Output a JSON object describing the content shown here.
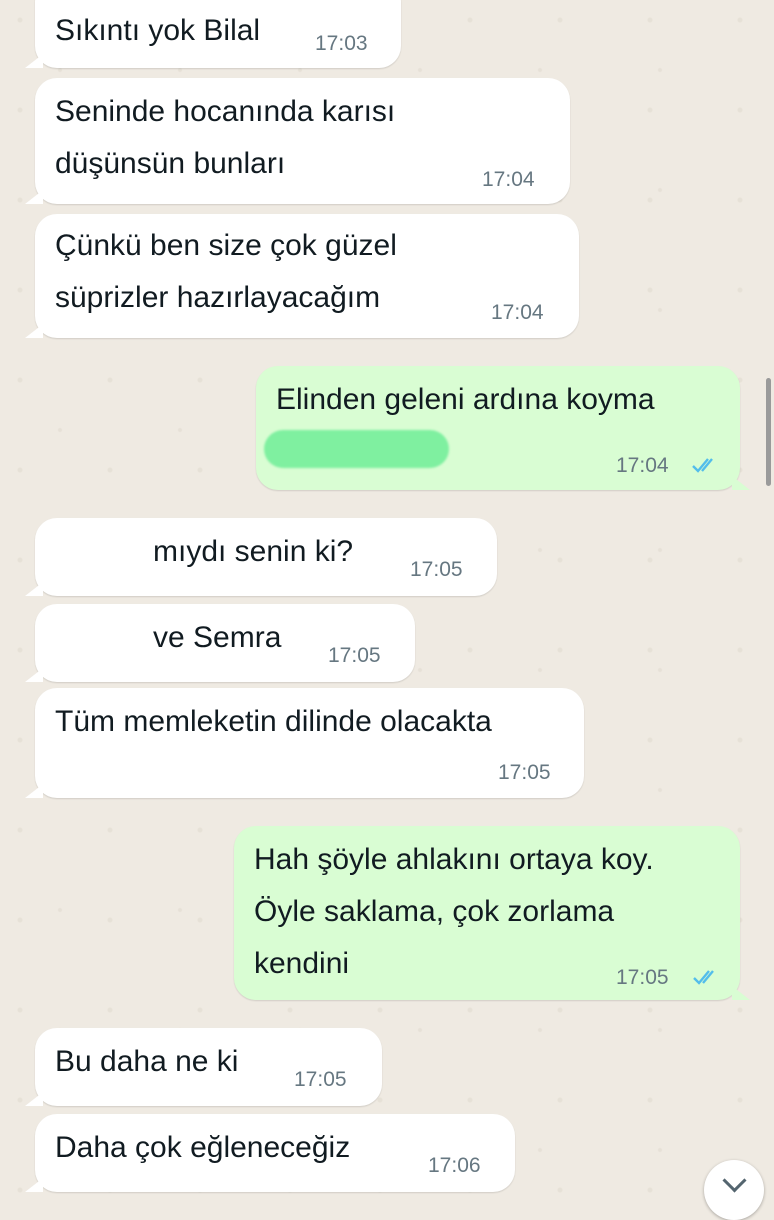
{
  "messages": [
    {
      "text": "Sıkıntı yok Bilal",
      "time": "17:03"
    },
    {
      "text": "Seninde hocanında karısı\ndüşünsün bunları",
      "time": "17:04"
    },
    {
      "text": "Çünkü ben size çok güzel\nsüprizler hazırlayacağım",
      "time": "17:04"
    },
    {
      "text": "Elinden geleni ardına koyma",
      "time": "17:04"
    },
    {
      "text": "mıydı senin ki?",
      "time": "17:05"
    },
    {
      "text": "ve Semra",
      "time": "17:05"
    },
    {
      "text": "Tüm memleketin dilinde olacakta",
      "time": "17:05"
    },
    {
      "text": "Hah şöyle ahlakını ortaya koy.\nÖyle saklama, çok zorlama\nkendini",
      "time": "17:05"
    },
    {
      "text": "Bu daha ne ki",
      "time": "17:05"
    },
    {
      "text": "Daha çok eğleneceğiz",
      "time": "17:06"
    }
  ],
  "colors": {
    "incoming_bubble": "#ffffff",
    "outgoing_bubble": "#d9fdd3",
    "read_ticks": "#53bdeb",
    "chat_background": "#efeae2"
  }
}
